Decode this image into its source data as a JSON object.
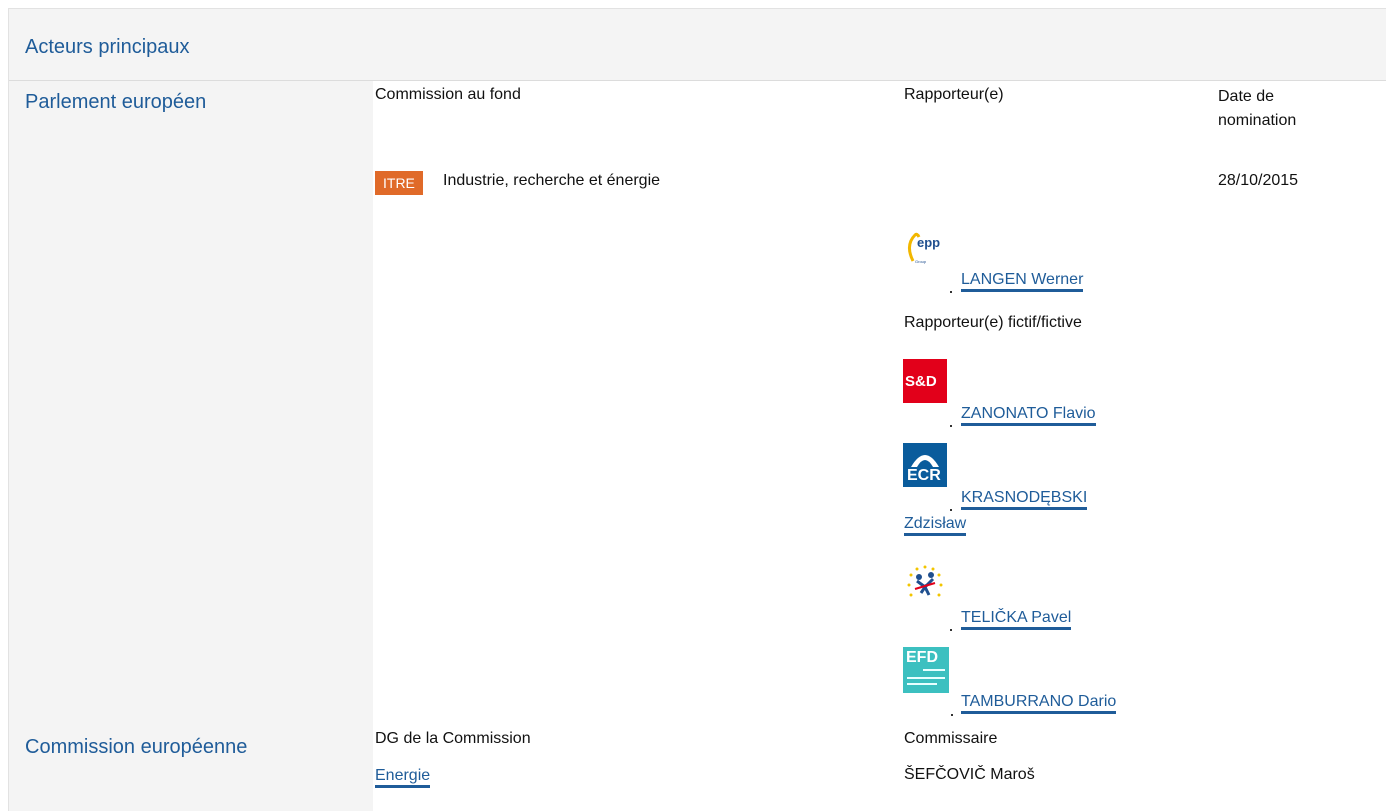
{
  "header": {
    "title": "Acteurs principaux"
  },
  "parliament": {
    "label": "Parlement européen",
    "col_committee": "Commission au fond",
    "col_rapporteur": "Rapporteur(e)",
    "col_date": "Date de nomination",
    "committee_badge": "ITRE",
    "committee_name": "Industrie, recherche et énergie",
    "date": "28/10/2015",
    "rapporteur": {
      "name": "LANGEN Werner",
      "logo": "epp-logo"
    },
    "shadow_label": "Rapporteur(e) fictif/fictive",
    "shadows": [
      {
        "name": "ZANONATO Flavio",
        "logo": "sd-logo",
        "logo_text": "S&D"
      },
      {
        "name_line1": "KRASNODĘBSKI",
        "name_line2": "Zdzisław",
        "logo": "ecr-logo",
        "logo_text": "ECR"
      },
      {
        "name": "TELIČKA Pavel",
        "logo": "alde-logo"
      },
      {
        "name": "TAMBURRANO Dario",
        "logo": "efdd-logo",
        "logo_text": "EFD"
      }
    ]
  },
  "commission": {
    "label": "Commission européenne",
    "col_dg": "DG de la Commission",
    "col_commissioner": "Commissaire",
    "dg": "Energie",
    "commissioner": "ŠEFČOVIČ Maroš"
  },
  "colors": {
    "accent": "#1f5c99",
    "badge": "#e06a29",
    "sd": "#e2001a",
    "ecr": "#0a5c9c",
    "efd": "#3cc0c0"
  }
}
